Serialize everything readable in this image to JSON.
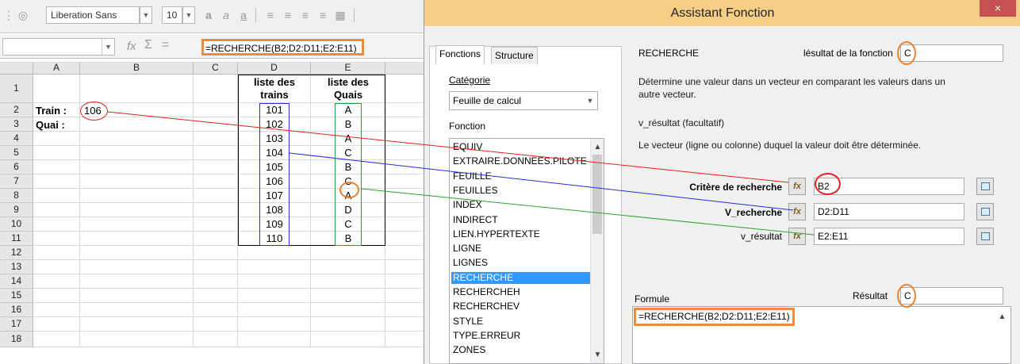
{
  "toolbar": {
    "font_name": "Liberation Sans",
    "font_size": "10",
    "name_box": ""
  },
  "formula_bar": {
    "content": "=RECHERCHE(B2;D2:D11;E2:E11)"
  },
  "sheet": {
    "columns": [
      "A",
      "B",
      "C",
      "D",
      "E"
    ],
    "rows": [
      "1",
      "2",
      "3",
      "4",
      "5",
      "6",
      "7",
      "8",
      "9",
      "10",
      "11",
      "12",
      "13",
      "14",
      "15",
      "16",
      "17",
      "18"
    ],
    "labels": {
      "train": "Train :",
      "quai": "Quai :"
    },
    "train_value": "106",
    "header_d": [
      "liste des",
      "trains"
    ],
    "header_e": [
      "liste des",
      "Quais"
    ],
    "trains": [
      "101",
      "102",
      "103",
      "104",
      "105",
      "106",
      "107",
      "108",
      "109",
      "110"
    ],
    "quais": [
      "A",
      "B",
      "A",
      "C",
      "B",
      "C",
      "A",
      "D",
      "C",
      "B"
    ]
  },
  "dialog": {
    "title": "Assistant Fonction",
    "close": "×",
    "tabs": [
      "Fonctions",
      "Structure"
    ],
    "category_label": "Catégorie",
    "category_value": "Feuille de calcul",
    "function_label": "Fonction",
    "functions": [
      "EQUIV",
      "EXTRAIRE.DONNEES.PILOTE",
      "FEUILLE",
      "FEUILLES",
      "INDEX",
      "INDIRECT",
      "LIEN.HYPERTEXTE",
      "LIGNE",
      "LIGNES",
      "RECHERCHE",
      "RECHERCHEH",
      "RECHERCHEV",
      "STYLE",
      "TYPE.ERREUR",
      "ZONES"
    ],
    "selected_function": "RECHERCHE",
    "func_name": "RECHERCHE",
    "result_label": "lésultat de la fonction",
    "result_value": "C",
    "description": [
      "Détermine une valeur dans un vecteur en comparant les valeurs dans un",
      "autre vecteur."
    ],
    "param_name": "v_résultat (facultatif)",
    "param_desc": "Le vecteur (ligne ou colonne) duquel la valeur doit être déterminée.",
    "arguments": [
      {
        "label": "Critère de recherche",
        "value": "B2"
      },
      {
        "label": "V_recherche",
        "value": "D2:D11"
      },
      {
        "label": "v_résultat",
        "value": "E2:E11"
      }
    ],
    "formula_label": "Formule",
    "resultat_label": "Résultat",
    "resultat_value": "C",
    "formula": "=RECHERCHE(B2;D2:D11;E2:E11)"
  }
}
